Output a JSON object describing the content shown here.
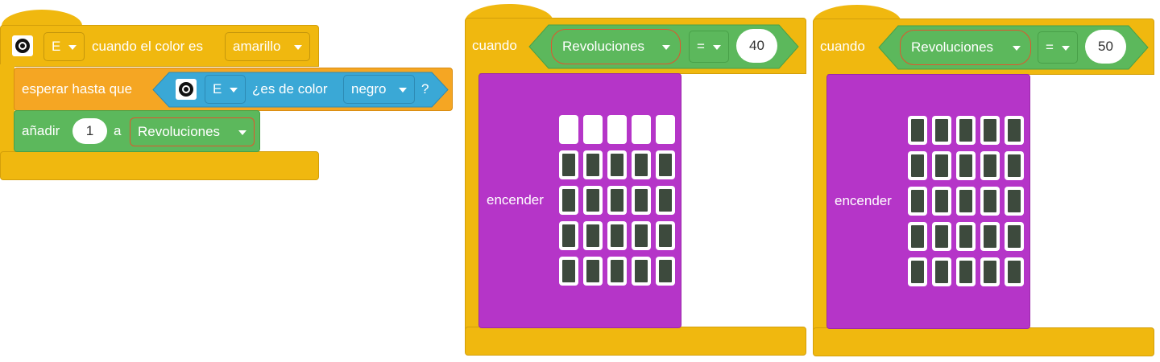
{
  "block1": {
    "port_value": "E",
    "label_when_color": "cuando el color es",
    "color_value": "amarillo",
    "wait_label": "esperar hasta que",
    "wait_port_value": "E",
    "is_color_label": "¿es de color",
    "wait_color_value": "negro",
    "question_mark": "?",
    "add_label": "añadir",
    "add_amount": "1",
    "add_to_label": "a",
    "variable": "Revoluciones"
  },
  "block2": {
    "when_label": "cuando",
    "variable": "Revoluciones",
    "operator": "=",
    "value": "40",
    "light_label": "encender",
    "grid": [
      [
        0,
        0,
        0,
        0,
        0
      ],
      [
        1,
        1,
        1,
        1,
        1
      ],
      [
        1,
        1,
        1,
        1,
        1
      ],
      [
        1,
        1,
        1,
        1,
        1
      ],
      [
        1,
        1,
        1,
        1,
        1
      ]
    ]
  },
  "block3": {
    "when_label": "cuando",
    "variable": "Revoluciones",
    "operator": "=",
    "value": "50",
    "light_label": "encender",
    "grid": [
      [
        1,
        1,
        1,
        1,
        1
      ],
      [
        1,
        1,
        1,
        1,
        1
      ],
      [
        1,
        1,
        1,
        1,
        1
      ],
      [
        1,
        1,
        1,
        1,
        1
      ],
      [
        1,
        1,
        1,
        1,
        1
      ]
    ]
  },
  "colors": {
    "event_yellow": "#f0b80f",
    "operator_green": "#5cb85c",
    "sensor_blue": "#3aa8d6",
    "control_orange": "#f5a623",
    "display_purple": "#b535c8",
    "variable_outline": "#e0552e"
  }
}
